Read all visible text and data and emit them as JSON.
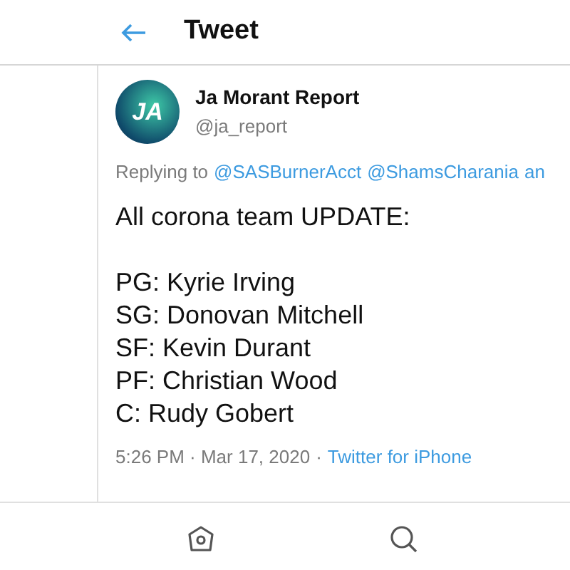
{
  "header": {
    "title": "Tweet"
  },
  "tweet": {
    "avatar_text": "JA",
    "name": "Ja Morant Report",
    "handle": "@ja_report",
    "replying": {
      "prefix": "Replying to",
      "mentions": [
        "@SASBurnerAcct",
        "@ShamsCharania",
        "an"
      ]
    },
    "paragraphs": [
      [
        "All corona team UPDATE:"
      ],
      [
        "PG: Kyrie Irving",
        "SG: Donovan Mitchell",
        "SF: Kevin Durant",
        "PF: Christian Wood",
        "C: Rudy Gobert"
      ]
    ],
    "time": "5:26 PM · Mar 17, 2020",
    "separator": "·",
    "source": "Twitter for iPhone"
  },
  "tabbar": [
    {
      "kind": "home"
    },
    {
      "kind": "search"
    }
  ]
}
